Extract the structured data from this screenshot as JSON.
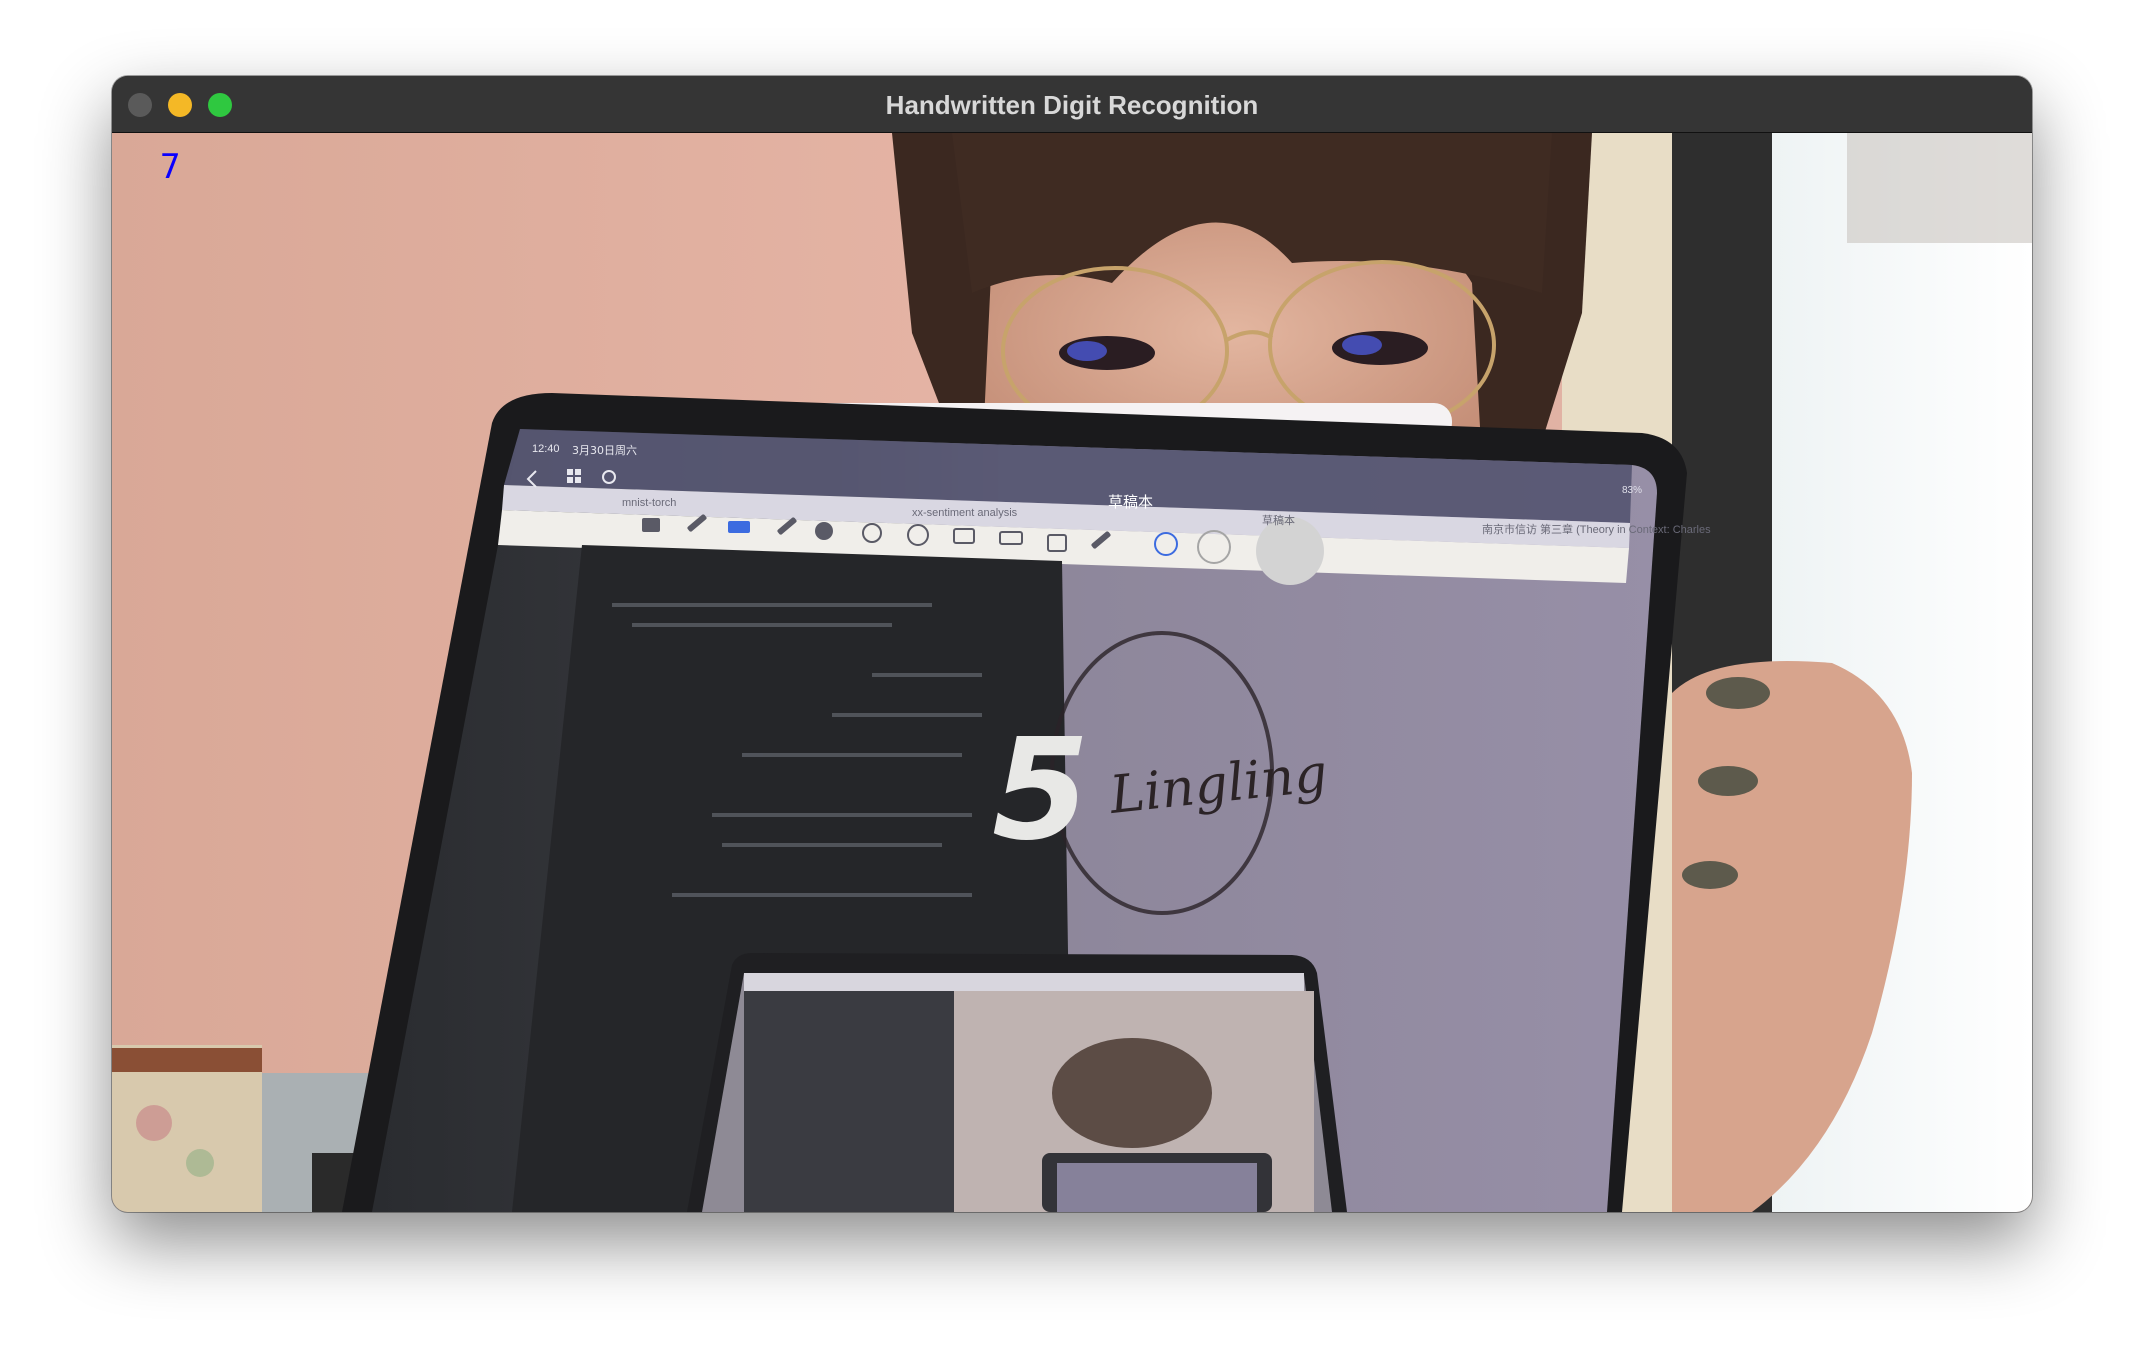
{
  "window": {
    "title": "Handwritten Digit Recognition",
    "traffic_lights": [
      "close",
      "minimize",
      "maximize"
    ]
  },
  "overlay": {
    "prediction": "7"
  },
  "tablet": {
    "status_time": "12:40",
    "status_date": "3月30日周六",
    "battery": "83%",
    "doc_title": "草稿本",
    "tabs": [
      "mnist-torch",
      "xx-sentiment analysis",
      "草稿本",
      "南京市信访 第三章 (Theory in Context: Charles"
    ],
    "handwriting_digit": "5",
    "handwriting_signature": "Lingling"
  }
}
